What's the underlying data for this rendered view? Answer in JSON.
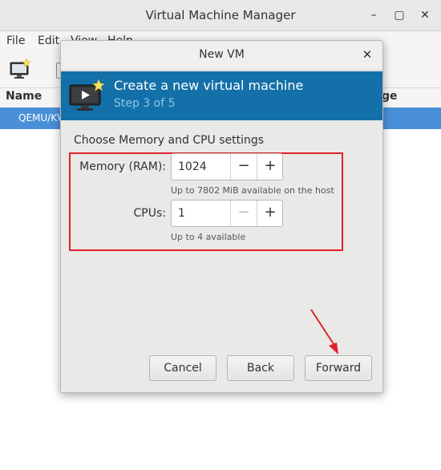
{
  "window": {
    "title": "Virtual Machine Manager",
    "minimize_glyph": "–",
    "maximize_glyph": "▢",
    "close_glyph": "✕"
  },
  "menu": {
    "file": "File",
    "edit": "Edit",
    "view": "View",
    "help": "Help"
  },
  "list": {
    "header_name": "Name",
    "header_usage": "ge",
    "selected_row": "QEMU/KV"
  },
  "dialog": {
    "title": "New VM",
    "close_glyph": "✕",
    "banner_title": "Create a new virtual machine",
    "banner_subtitle": "Step 3 of 5",
    "section_label": "Choose Memory and CPU settings",
    "memory": {
      "label": "Memory (RAM):",
      "value": "1024",
      "hint": "Up to 7802 MiB available on the host"
    },
    "cpus": {
      "label": "CPUs:",
      "value": "1",
      "hint": "Up to 4 available"
    },
    "minus_glyph": "−",
    "plus_glyph": "+",
    "buttons": {
      "cancel": "Cancel",
      "back": "Back",
      "forward": "Forward"
    }
  },
  "colors": {
    "banner": "#1470a8",
    "selection": "#4a90d9",
    "annotation": "#e0212b"
  },
  "icons": {
    "toolbar": "new-vm-icon",
    "banner": "new-vm-icon",
    "close": "close-icon",
    "annotation": "red-arrow"
  }
}
